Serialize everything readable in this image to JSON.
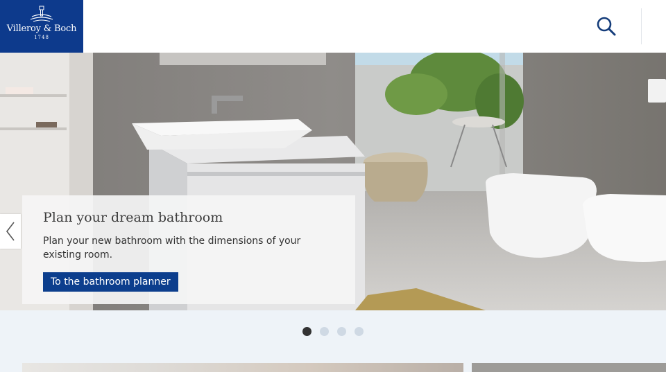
{
  "brand": {
    "name": "Villeroy & Boch",
    "year": "1748",
    "color": "#0d3a8c"
  },
  "header": {
    "search_icon": "search-icon"
  },
  "hero": {
    "title": "Plan your dream bathroom",
    "text": "Plan your new bathroom with the dimensions of your existing room.",
    "cta": "To the bathroom planner",
    "prev_icon": "chevron-left-icon"
  },
  "carousel": {
    "slides": 4,
    "active": 1
  },
  "colors": {
    "cta": "#0c3e8d",
    "dot_active": "#333333",
    "dot_inactive": "#cfd9e4"
  }
}
